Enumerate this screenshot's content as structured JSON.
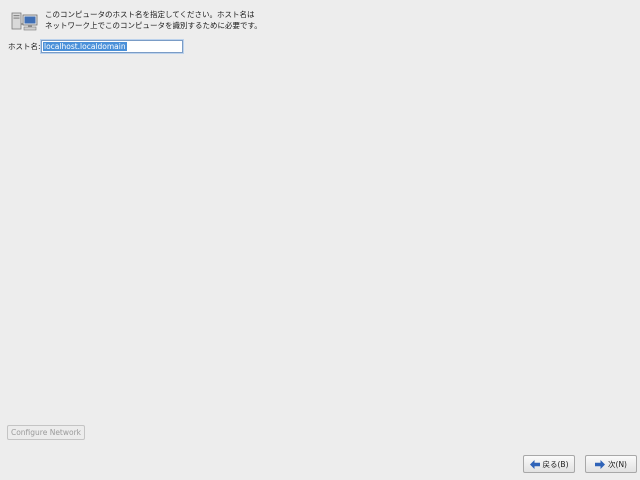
{
  "header": {
    "icon": "network-computers-icon",
    "line1": "このコンピュータのホスト名を指定してください。ホスト名は",
    "line2": "ネットワーク上でこのコンピュータを識別するために必要です。"
  },
  "hostname": {
    "label": "ホスト名:",
    "value": "localhost.localdomain"
  },
  "configure_network": {
    "label": "Configure Network"
  },
  "navigation": {
    "back_label": "戻る(B)",
    "back_icon": "arrow-left-icon",
    "next_label": "次(N)",
    "next_icon": "arrow-right-icon",
    "arrow_color": "#2f63b8"
  }
}
